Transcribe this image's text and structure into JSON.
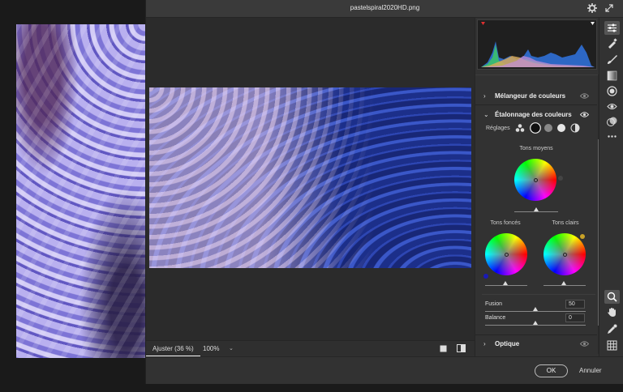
{
  "window": {
    "title": "pastelspiral2020HD.png"
  },
  "statusbar": {
    "fit_label": "Ajuster (36 %)",
    "zoom_label": "100%"
  },
  "footer": {
    "ok_label": "OK",
    "cancel_label": "Annuler"
  },
  "panel": {
    "sections": {
      "melangeur": "Mélangeur de couleurs",
      "etalonnage": "Étalonnage des couleurs",
      "optique": "Optique"
    },
    "reglages_label": "Réglages",
    "wheels": {
      "midtones": "Tons moyens",
      "shadows": "Tons foncés",
      "highlights": "Tons clairs"
    },
    "fusion": {
      "label": "Fusion",
      "value": "50",
      "fraction": 0.5
    },
    "balance": {
      "label": "Balance",
      "value": "0",
      "fraction": 0.5
    }
  },
  "colors": {
    "accent": "#3b3bd1",
    "highlight_dot": "#c9a227",
    "shadow_dot": "#1a1ab5",
    "histogram_clip_warning": "#e03030"
  },
  "icons": {
    "toolbar": [
      "edit-sliders-icon",
      "healing-brush-icon",
      "brush-icon",
      "gradient-icon",
      "radial-filter-icon",
      "red-eye-icon",
      "presets-icon",
      "more-icon",
      "zoom-icon",
      "hand-icon",
      "color-sampler-icon",
      "grid-icon"
    ],
    "title": [
      "gear-icon",
      "fullscreen-icon"
    ]
  }
}
